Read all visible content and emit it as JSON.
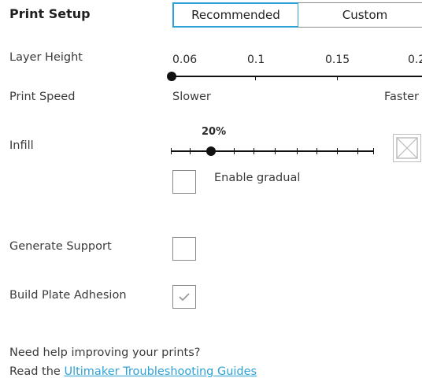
{
  "header": {
    "title": "Print Setup",
    "tabs": [
      {
        "label": "Recommended",
        "active": true
      },
      {
        "label": "Custom",
        "active": false
      }
    ],
    "accent_color": "#2da1d6"
  },
  "layer_height": {
    "label": "Layer Height",
    "options": [
      "0.06",
      "0.1",
      "0.15",
      "0.2"
    ],
    "selected": "0.06"
  },
  "print_speed": {
    "label": "Print Speed",
    "min_label": "Slower",
    "max_label": "Faster"
  },
  "infill": {
    "label": "Infill",
    "value_label": "20%",
    "value_percent": 20,
    "gradual_label": "Enable gradual",
    "gradual_checked": false,
    "pattern_icon": "infill-pattern-icon"
  },
  "support": {
    "label": "Generate Support",
    "checked": false
  },
  "adhesion": {
    "label": "Build Plate Adhesion",
    "checked": true
  },
  "help": {
    "line1": "Need help improving your prints?",
    "prefix": "Read the ",
    "link_text": "Ultimaker Troubleshooting Guides"
  }
}
